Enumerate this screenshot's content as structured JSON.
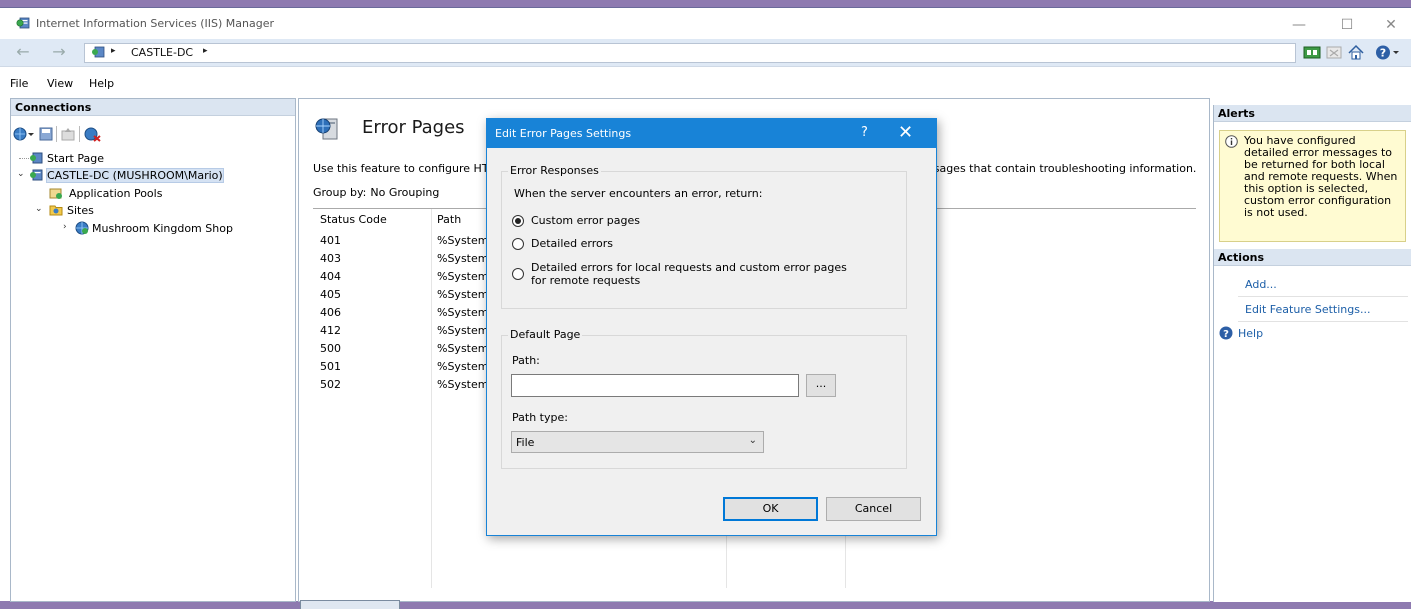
{
  "window": {
    "title": "Internet Information Services (IIS) Manager",
    "controls": {
      "minimize": "—",
      "maximize": "☐",
      "close": "✕"
    }
  },
  "address": {
    "back": "←",
    "forward": "→",
    "path_separator": "▸",
    "server": "CASTLE-DC"
  },
  "menu": {
    "file": "File",
    "view": "View",
    "help": "Help"
  },
  "connections": {
    "title": "Connections",
    "tree": [
      {
        "label": "Start Page",
        "icon": "start-page-icon"
      },
      {
        "label": "CASTLE-DC (MUSHROOM\\Mario)",
        "icon": "server-icon",
        "toggle": "⌄",
        "selected": true
      },
      {
        "label": "Application Pools",
        "icon": "app-pools-icon"
      },
      {
        "label": "Sites",
        "icon": "sites-folder-icon",
        "toggle": "⌄"
      },
      {
        "label": "Mushroom Kingdom Shop",
        "icon": "website-icon",
        "toggle": "›"
      }
    ]
  },
  "main": {
    "title": "Error Pages",
    "description": "Use this feature to configure HTT",
    "description_tail": "ssages that contain troubleshooting information.",
    "group_by_label": "Group by:",
    "group_by_value": "No Grouping",
    "columns": [
      "Status Code",
      "Path"
    ],
    "rows": [
      {
        "status": "401",
        "path": "%System"
      },
      {
        "status": "403",
        "path": "%System"
      },
      {
        "status": "404",
        "path": "%System"
      },
      {
        "status": "405",
        "path": "%System"
      },
      {
        "status": "406",
        "path": "%System"
      },
      {
        "status": "412",
        "path": "%System"
      },
      {
        "status": "500",
        "path": "%System"
      },
      {
        "status": "501",
        "path": "%System"
      },
      {
        "status": "502",
        "path": "%System"
      }
    ]
  },
  "alerts": {
    "title": "Alerts",
    "message": "You have configured detailed error messages to be returned for both local and remote requests. When this option is selected, custom error configuration is not used."
  },
  "actions": {
    "title": "Actions",
    "add": "Add...",
    "edit_feature_settings": "Edit Feature Settings...",
    "help": "Help"
  },
  "dialog": {
    "title": "Edit Error Pages Settings",
    "help_button": "?",
    "close_button": "✕",
    "error_responses": {
      "legend": "Error Responses",
      "prompt": "When the server encounters an error, return:",
      "options": [
        {
          "label": "Custom error pages",
          "selected": true
        },
        {
          "label": "Detailed errors",
          "selected": false
        },
        {
          "label_line1": "Detailed errors for local requests and custom error pages",
          "label_line2": "for remote requests",
          "selected": false
        }
      ]
    },
    "default_page": {
      "legend": "Default Page",
      "path_label": "Path:",
      "path_value": "",
      "browse_button": "...",
      "path_type_label": "Path type:",
      "path_type_value": "File"
    },
    "ok": "OK",
    "cancel": "Cancel"
  },
  "colors": {
    "accent": "#1883d7",
    "panel_header": "#dbe5f1",
    "alert_background": "#fffbd2",
    "link": "#1d5fa8"
  }
}
